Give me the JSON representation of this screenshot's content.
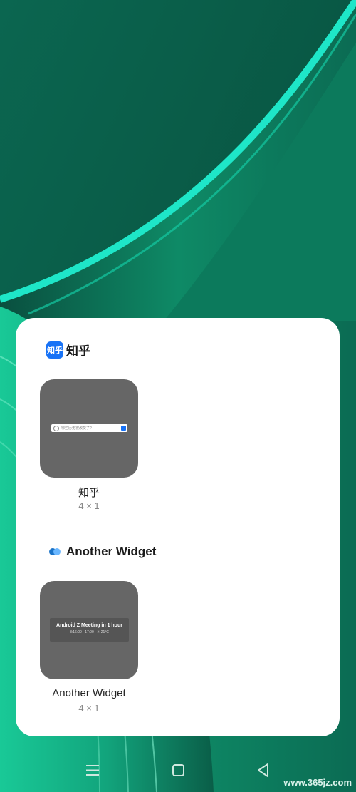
{
  "apps": [
    {
      "name": "知乎",
      "icon_text": "知乎",
      "widget": {
        "label": "知乎",
        "size": "4 × 1",
        "search_placeholder": "哪些历史被改变了?"
      }
    },
    {
      "name": "Another Widget",
      "widget": {
        "label": "Another Widget",
        "size": "4 × 1",
        "event_title": "Android Z Meeting in 1 hour",
        "event_detail": "8:16:00 - 17:00 | ☀ 21°C"
      }
    }
  ],
  "nav": {
    "menu_icon": "menu-icon",
    "home_icon": "home-icon",
    "back_icon": "back-icon"
  },
  "watermark": "www.365jz.com",
  "colors": {
    "wallpaper_dark": "#0a5e48",
    "accent_teal": "#19e3c4",
    "panel": "#ffffff",
    "preview": "#666666",
    "zhihu_blue": "#1772f6"
  }
}
